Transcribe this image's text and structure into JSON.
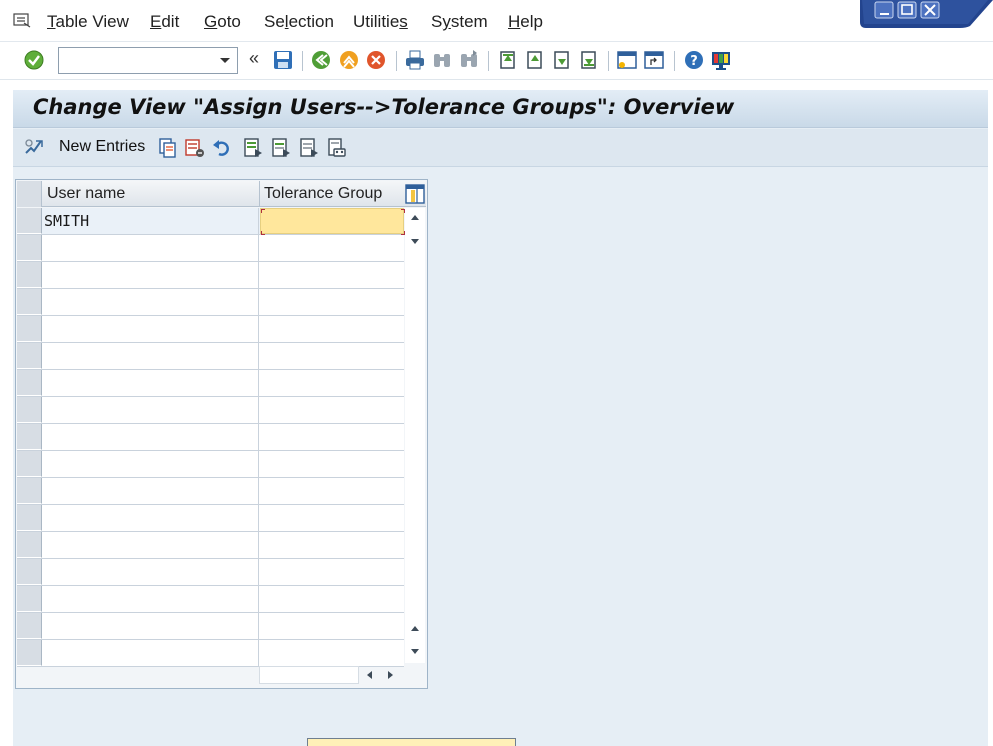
{
  "menubar": {
    "items": [
      {
        "label": "Table View",
        "underline_index": 0
      },
      {
        "label": "Edit",
        "underline_index": 0
      },
      {
        "label": "Goto",
        "underline_index": 0
      },
      {
        "label": "Selection",
        "underline_index": 2
      },
      {
        "label": "Utilities",
        "underline_index": 8
      },
      {
        "label": "System",
        "underline_index": 1
      },
      {
        "label": "Help",
        "underline_index": 0
      }
    ]
  },
  "toolbar": {
    "command_field_value": "",
    "back_arrows": "«",
    "icons": [
      "enter-icon",
      "save-icon",
      "back-icon",
      "exit-icon",
      "cancel-icon",
      "print-icon",
      "find-icon",
      "find-next-icon",
      "first-page-icon",
      "previous-page-icon",
      "next-page-icon",
      "last-page-icon",
      "create-session-icon",
      "shortcut-icon",
      "help-icon",
      "customize-layout-icon"
    ]
  },
  "page": {
    "title": "Change View \"Assign Users-->Tolerance Groups\": Overview"
  },
  "app_toolbar": {
    "new_entries_label": "New Entries",
    "icons": [
      "display-change-icon",
      "copy-as-icon",
      "delete-icon",
      "undo-change-icon",
      "select-all-icon",
      "select-block-icon",
      "deselect-all-icon",
      "print-standard-list-icon"
    ]
  },
  "table": {
    "columns": [
      "User name",
      "Tolerance Group"
    ],
    "rows": [
      {
        "user_name": "SMITH",
        "tolerance_group": ""
      }
    ],
    "empty_rows": 16
  },
  "colors": {
    "title_bg": "#c9d9e8",
    "content_bg": "#e6eef5",
    "highlight_field": "#ffe79c",
    "window_controls": "#1f3f8f"
  }
}
